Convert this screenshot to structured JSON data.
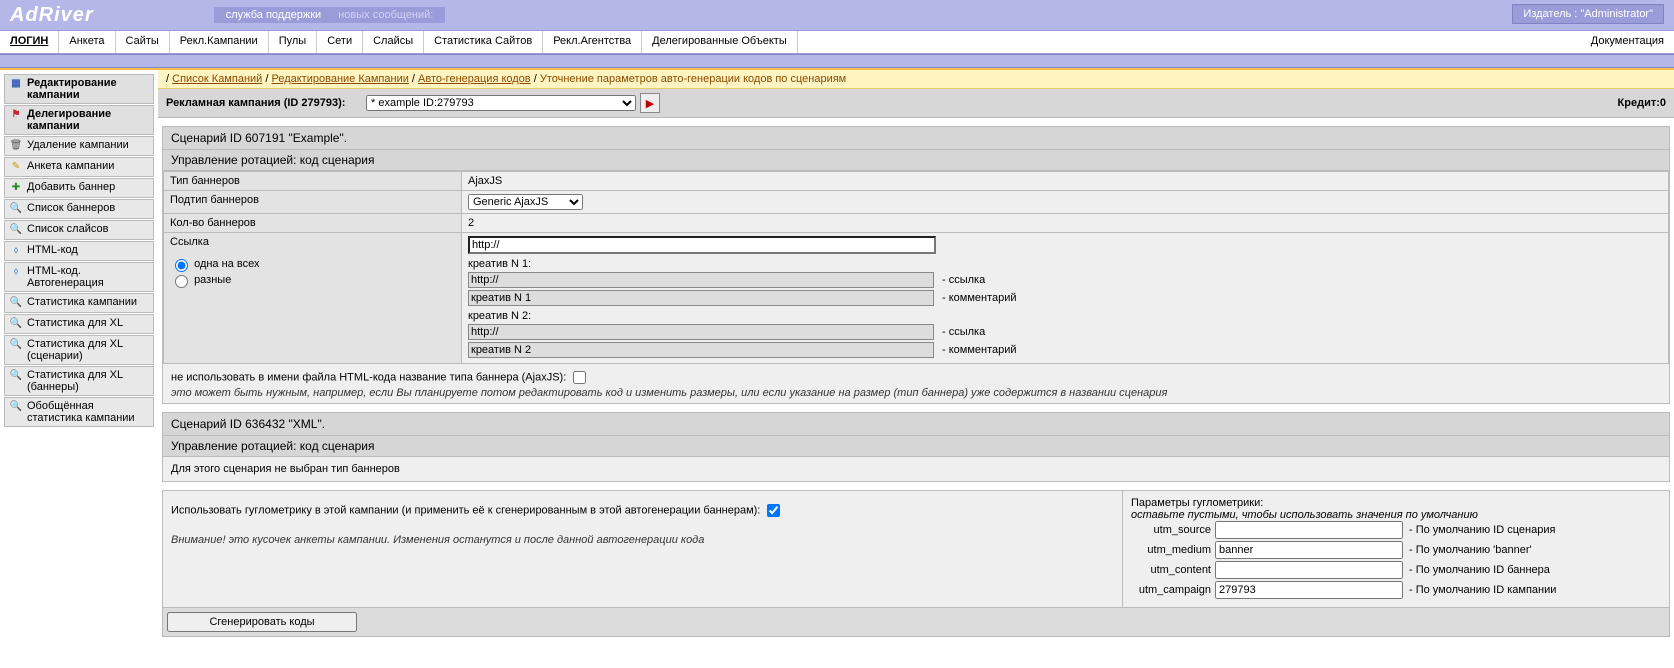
{
  "top": {
    "logo": "AdRiver",
    "support": "служба поддержки",
    "newmsg": "новых сообщений:",
    "publisher": "Издатель  :  \"Administrator\""
  },
  "menu": {
    "items": [
      "ЛОГИН",
      "Анкета",
      "Сайты",
      "Рекл.Кампании",
      "Пулы",
      "Сети",
      "Слайсы",
      "Статистика Сайтов",
      "Рекл.Агентства",
      "Делегированные Объекты"
    ],
    "last": "Документация"
  },
  "crumbs": {
    "a": "Список Кампаний",
    "b": "Редактирование Кампании",
    "c": "Авто-генерация кодов",
    "cur": "Уточнение параметров авто-генерации кодов по сценариям"
  },
  "head": {
    "title": "Рекламная кампания (ID 279793):",
    "select": "* example ID:279793",
    "credit": "Кредит:0"
  },
  "sidebar": {
    "items": [
      {
        "ic": "▦",
        "ic_color": "#3a5fb8",
        "label": "Редактирование кампании",
        "active": true
      },
      {
        "ic": "⚑",
        "ic_color": "#c23",
        "label": "Делегирование кампании",
        "active": true
      },
      {
        "ic": "🗑",
        "ic_color": "#555",
        "label": "Удаление кампании"
      },
      {
        "ic": "✎",
        "ic_color": "#c90",
        "label": "Анкета кампании"
      },
      {
        "ic": "✚",
        "ic_color": "#2a8a2a",
        "label": "Добавить баннер"
      },
      {
        "ic": "🔍",
        "ic_color": "#555",
        "label": "Список баннеров"
      },
      {
        "ic": "🔍",
        "ic_color": "#555",
        "label": "Список слайсов"
      },
      {
        "ic": "⬨",
        "ic_color": "#2b6fb5",
        "label": "HTML-код"
      },
      {
        "ic": "⬨",
        "ic_color": "#2b6fb5",
        "label": "HTML-код. Автогенерация"
      },
      {
        "ic": "🔍",
        "ic_color": "#555",
        "label": "Статистика кампании"
      },
      {
        "ic": "🔍",
        "ic_color": "#555",
        "label": "Статистика для XL"
      },
      {
        "ic": "🔍",
        "ic_color": "#555",
        "label": "Статистика для XL (сценарии)"
      },
      {
        "ic": "🔍",
        "ic_color": "#555",
        "label": "Статистика для XL (баннеры)"
      },
      {
        "ic": "🔍",
        "ic_color": "#555",
        "label": "Обобщённая статистика кампании"
      }
    ]
  },
  "sc1": {
    "title": "Сценарий ID 607191 \"Example\".",
    "sub": "Управление ротацией: код сценария",
    "rows": {
      "type_k": "Тип баннеров",
      "type_v": "AjaxJS",
      "sub_k": "Подтип баннеров",
      "sub_v": "Generic AjaxJS",
      "cnt_k": "Кол-во баннеров",
      "cnt_v": "2",
      "link_k": "Ссылка",
      "link_one": "одна на всех",
      "link_diff": "разные",
      "url": "http://",
      "c1_label": "креатив N 1:",
      "c1_url": "http://",
      "c1_url_note": "- ссылка",
      "c1_comment": "креатив N 1",
      "c1_comment_note": "- комментарий",
      "c2_label": "креатив N 2:",
      "c2_url": "http://",
      "c2_url_note": "- ссылка",
      "c2_comment": "креатив N 2",
      "c2_comment_note": "- комментарий"
    },
    "footlabel": "не использовать в имени файла HTML-кода название типа баннера (AjaxJS):",
    "footnote": "это может быть нужным, например, если Вы планируете потом редактировать код и изменить размеры, или если указание на размер (тип баннера) уже содержится в названии сценария"
  },
  "sc2": {
    "title": "Сценарий ID 636432 \"XML\".",
    "sub": "Управление ротацией: код сценария",
    "warn": "Для этого сценария не выбран тип баннеров"
  },
  "gm": {
    "left_line1": "Использовать гуглометрику в этой кампании (и применить её к сгенерированным в этой автогенерации баннерам):",
    "left_line2": "Внимание! это кусочек анкеты кампании. Изменения останутся и после данной автогенерации кода",
    "right_title": "Параметры гуглометрики:",
    "right_sub": "оставьте пустыми, чтобы использовать значения по умолчанию",
    "rows": [
      {
        "label": "utm_source",
        "val": "",
        "hint": "- По умолчанию ID сценария"
      },
      {
        "label": "utm_medium",
        "val": "banner",
        "hint": "- По умолчанию 'banner'"
      },
      {
        "label": "utm_content",
        "val": "",
        "hint": "- По умолчанию ID баннера"
      },
      {
        "label": "utm_campaign",
        "val": "279793",
        "hint": "- По умолчанию ID кампании"
      }
    ]
  },
  "gen": "Сгенерировать коды"
}
